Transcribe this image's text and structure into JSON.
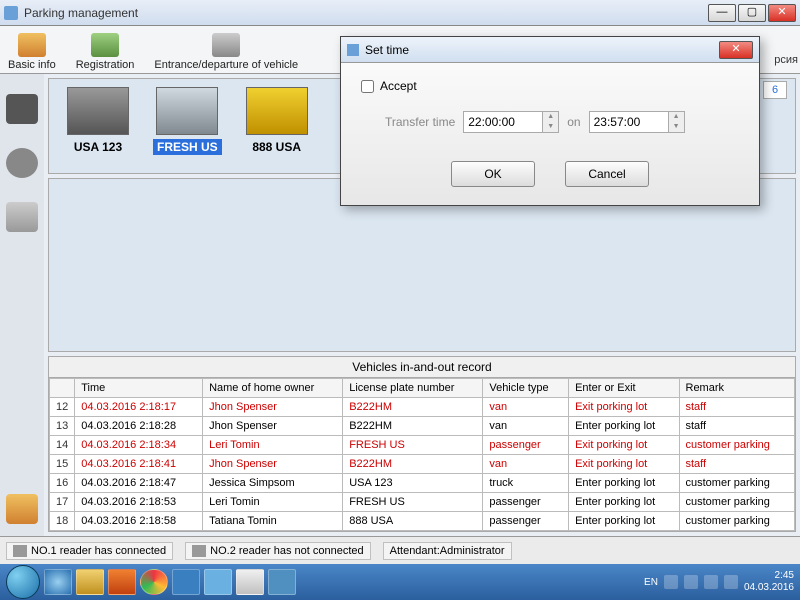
{
  "window": {
    "title": "Parking management"
  },
  "toolbar": {
    "basic": "Basic info",
    "registration": "Registration",
    "entrance": "Entrance/departure of vehicle"
  },
  "countBox": "6",
  "version_fragment": "рсия",
  "vehicles": [
    {
      "label": "USA 123",
      "selected": false
    },
    {
      "label": "FRESH US",
      "selected": true
    },
    {
      "label": "888 USA",
      "selected": false
    }
  ],
  "table": {
    "title": "Vehicles in-and-out record",
    "headers": [
      "Time",
      "Name of home owner",
      "License plate number",
      "Vehicle type",
      "Enter or Exit",
      "Remark"
    ],
    "rows": [
      {
        "n": "12",
        "red": true,
        "c": [
          "04.03.2016 2:18:17",
          "Jhon Spenser",
          "B222HM",
          "van",
          "Exit porking lot",
          "staff"
        ]
      },
      {
        "n": "13",
        "red": false,
        "c": [
          "04.03.2016 2:18:28",
          "Jhon Spenser",
          "B222HM",
          "van",
          "Enter porking lot",
          "staff"
        ]
      },
      {
        "n": "14",
        "red": true,
        "c": [
          "04.03.2016 2:18:34",
          "Leri Tomin",
          "FRESH US",
          "passenger",
          "Exit porking lot",
          "customer parking"
        ]
      },
      {
        "n": "15",
        "red": true,
        "c": [
          "04.03.2016 2:18:41",
          "Jhon Spenser",
          "B222HM",
          "van",
          "Exit porking lot",
          "staff"
        ]
      },
      {
        "n": "16",
        "red": false,
        "c": [
          "04.03.2016 2:18:47",
          "Jessica Simpsom",
          "USA 123",
          "truck",
          "Enter porking lot",
          "customer parking"
        ]
      },
      {
        "n": "17",
        "red": false,
        "c": [
          "04.03.2016 2:18:53",
          "Leri Tomin",
          "FRESH US",
          "passenger",
          "Enter porking lot",
          "customer parking"
        ]
      },
      {
        "n": "18",
        "red": false,
        "c": [
          "04.03.2016 2:18:58",
          "Tatiana Tomin",
          "888 USA",
          "passenger",
          "Enter porking lot",
          "customer parking"
        ]
      }
    ]
  },
  "status": {
    "reader1": "NO.1 reader has connected",
    "reader2": "NO.2 reader has not connected",
    "attendant": "Attendant:Administrator"
  },
  "tray": {
    "lang": "EN",
    "time": "2:45",
    "date": "04.03.2016"
  },
  "modal": {
    "title": "Set time",
    "accept": "Accept",
    "transfer_label": "Transfer time",
    "time1": "22:00:00",
    "on": "on",
    "time2": "23:57:00",
    "ok": "OK",
    "cancel": "Cancel"
  }
}
